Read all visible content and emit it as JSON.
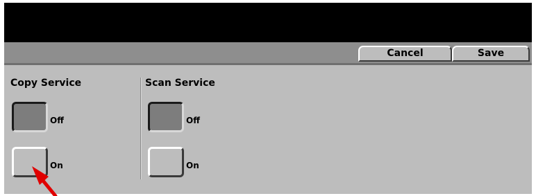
{
  "toolbar": {
    "cancel_label": "Cancel",
    "save_label": "Save"
  },
  "copy_service": {
    "title": "Copy Service",
    "options": [
      {
        "label": "Off",
        "selected": true
      },
      {
        "label": "On",
        "selected": false
      }
    ]
  },
  "scan_service": {
    "title": "Scan Service",
    "options": [
      {
        "label": "Off",
        "selected": true
      },
      {
        "label": "On",
        "selected": false
      }
    ]
  },
  "colors": {
    "panel": "#bdbdbd",
    "header": "#000000",
    "toolbar": "#8e8e8e",
    "pointer": "#e00000"
  },
  "pointer_icon": "red-arrow-icon"
}
